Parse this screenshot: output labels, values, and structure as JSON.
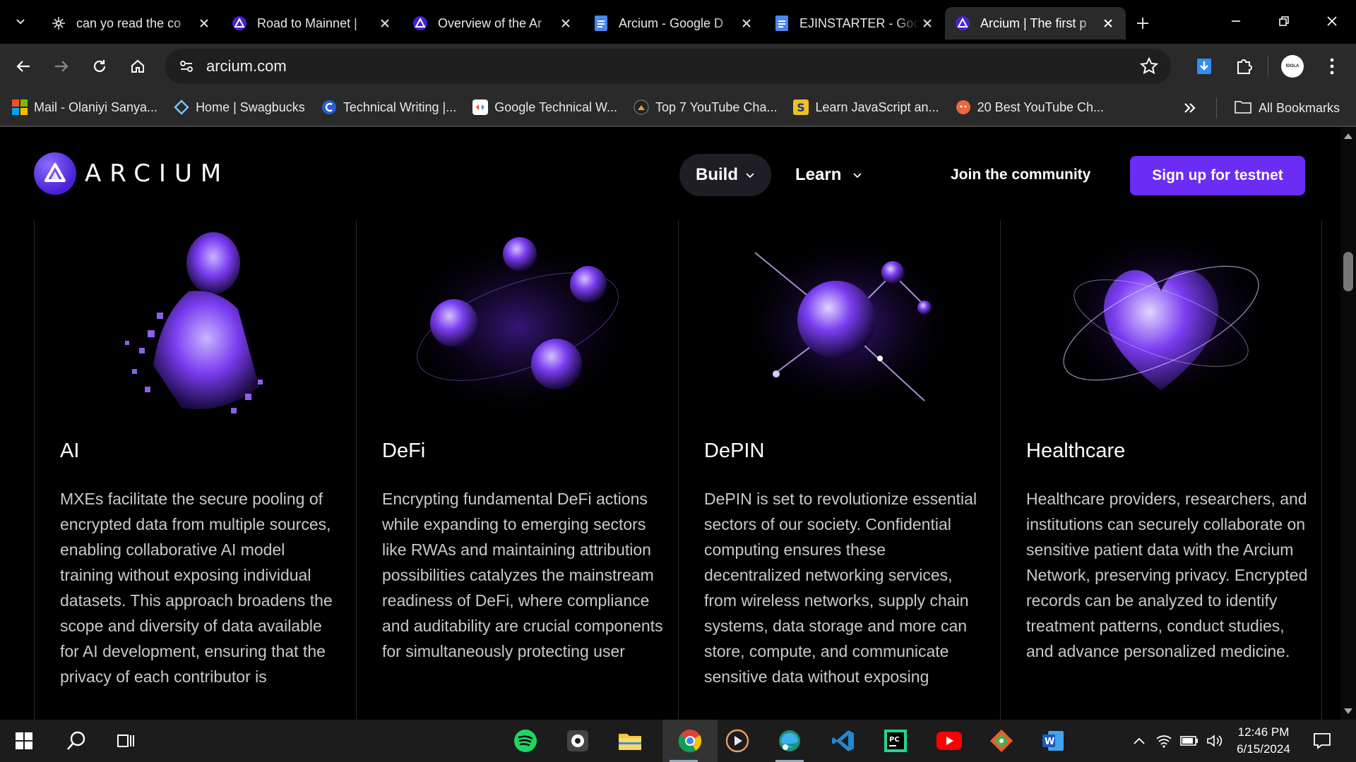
{
  "browser": {
    "tabs": [
      {
        "title": "can yo read the co",
        "favicon": "gear-flower-icon",
        "active": false
      },
      {
        "title": "Road to Mainnet |",
        "favicon": "arcium-icon",
        "active": false
      },
      {
        "title": "Overview of the Ar",
        "favicon": "arcium-icon",
        "active": false
      },
      {
        "title": "Arcium - Google D",
        "favicon": "google-docs-icon",
        "active": false
      },
      {
        "title": "EJINSTARTER - Goo",
        "favicon": "google-docs-icon",
        "active": false
      },
      {
        "title": "Arcium | The first p",
        "favicon": "arcium-icon",
        "active": true
      }
    ],
    "url": "arcium.com",
    "avatar_text": "IDOLA",
    "bookmarks": [
      {
        "label": "Mail - Olaniyi Sanya...",
        "icon": "windows-icon"
      },
      {
        "label": "Home | Swagbucks",
        "icon": "swagbucks-icon"
      },
      {
        "label": "Technical Writing |...",
        "icon": "c-icon"
      },
      {
        "label": "Google Technical W...",
        "icon": "google-icon"
      },
      {
        "label": "Top 7 YouTube Cha...",
        "icon": "odysee-icon"
      },
      {
        "label": "Learn JavaScript an...",
        "icon": "s-icon"
      },
      {
        "label": "20 Best YouTube Ch...",
        "icon": "orange-circle-icon"
      }
    ],
    "all_bookmarks_label": "All Bookmarks"
  },
  "site": {
    "logo_text": "ARCIUM",
    "nav": {
      "build": "Build",
      "learn": "Learn",
      "community": "Join the community",
      "cta": "Sign up for testnet"
    },
    "accent": "#6b2cf5",
    "cards": [
      {
        "title": "AI",
        "body": "MXEs facilitate the secure pooling of encrypted data from multiple sources, enabling collaborative AI model training without exposing individual datasets. This approach broadens the scope and diversity of data available for AI development, ensuring that the privacy of each contributor is"
      },
      {
        "title": "DeFi",
        "body": "Encrypting fundamental DeFi actions while expanding to emerging sectors like RWAs and maintaining attribution possibilities catalyzes the mainstream readiness of DeFi, where compliance and auditability are crucial components for simultaneously protecting user"
      },
      {
        "title": "DePIN",
        "body": "DePIN is set to revolutionize essential sectors of our society. Confidential computing ensures these decentralized networking services, from wireless networks, supply chain systems, data storage and more can store, compute, and communicate sensitive data without exposing"
      },
      {
        "title": "Healthcare",
        "body": "Healthcare providers, researchers, and institutions can securely collaborate on sensitive patient data with the Arcium Network, preserving privacy. Encrypted records can be analyzed to identify treatment patterns, conduct studies, and advance personalized medicine."
      }
    ]
  },
  "taskbar": {
    "time": "12:46 PM",
    "date": "6/15/2024"
  }
}
